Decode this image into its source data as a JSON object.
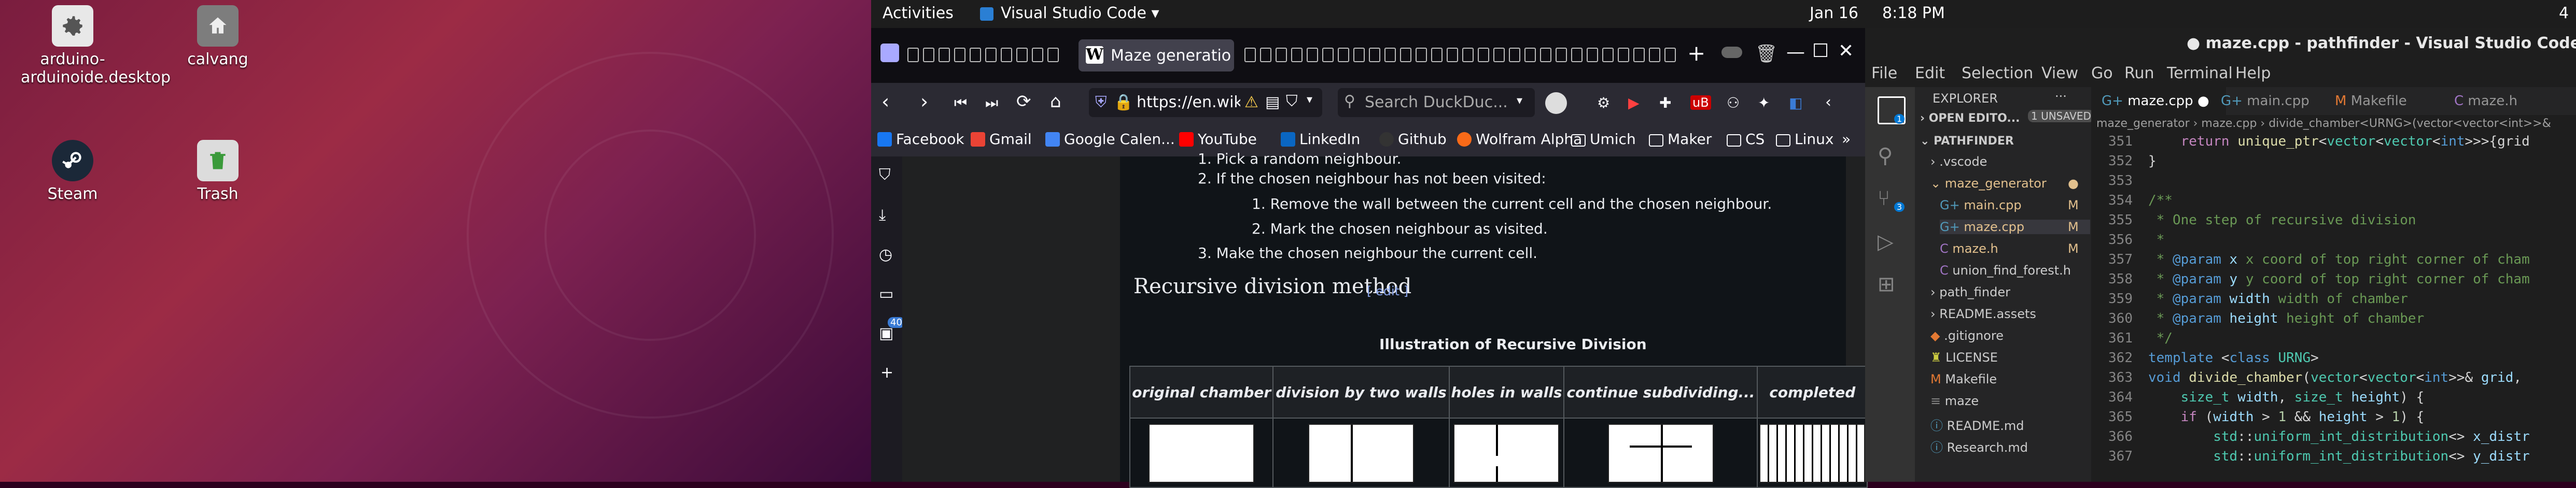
{
  "desktop": {
    "icons": [
      {
        "label": "arduino-arduinoide.desktop",
        "icon": "gear-icon"
      },
      {
        "label": "calvang",
        "icon": "home-folder-icon"
      },
      {
        "label": "Steam",
        "icon": "steam-icon"
      },
      {
        "label": "Trash",
        "icon": "trash-icon"
      }
    ]
  },
  "topbar": {
    "activities": "Activities",
    "app_menu": "Visual Studio Code ▾",
    "date": "Jan 16",
    "time": "8:18 PM",
    "right_fragment": "4"
  },
  "firefox": {
    "active_tab_label": "Maze generatio",
    "url": "https://en.wikipedia.org/wiki/Maze_generation_algorithm",
    "search_placeholder": "Search DuckDuc...",
    "sidebar_badge": "40",
    "bookmarks": [
      {
        "label": "Facebook",
        "color": "#1877f2"
      },
      {
        "label": "Gmail",
        "color": "#ea4335"
      },
      {
        "label": "Google Calen...",
        "color": "#4285f4"
      },
      {
        "label": "YouTube",
        "color": "#ff0000"
      },
      {
        "label": "LinkedIn",
        "color": "#0a66c2"
      },
      {
        "label": "Github",
        "color": "#333333"
      },
      {
        "label": "Wolfram Alpha",
        "color": "#f96a18"
      },
      {
        "label": "Umich",
        "color": "folder"
      },
      {
        "label": "Maker",
        "color": "folder"
      },
      {
        "label": "CS",
        "color": "folder"
      },
      {
        "label": "Linux",
        "color": "folder"
      }
    ],
    "article": {
      "step1": "1. Pick a random neighbour.",
      "step2": "2. If the chosen neighbour has not been visited:",
      "sub1": "1. Remove the wall between the current cell and the chosen neighbour.",
      "sub2": "2. Mark the chosen neighbour as visited.",
      "step3": "3. Make the chosen neighbour the current cell.",
      "heading": "Recursive division method",
      "edit_link": "[ edit ]",
      "table_caption": "Illustration of Recursive Division",
      "columns": [
        "original chamber",
        "division by two walls",
        "holes in walls",
        "continue subdividing...",
        "completed"
      ]
    }
  },
  "vscode": {
    "title": "● maze.cpp - pathfinder - Visual Studio Code",
    "menu": [
      "File",
      "Edit",
      "Selection",
      "View",
      "Go",
      "Run",
      "Terminal",
      "Help"
    ],
    "explorer": {
      "header": "EXPLORER",
      "open_editors": "OPEN EDITO...",
      "unsaved_badge": "1 UNSAVED",
      "root": "PATHFINDER",
      "items": [
        {
          "label": ".vscode",
          "indent": 1,
          "kind": "folder",
          "flag": ""
        },
        {
          "label": "maze_generator",
          "indent": 1,
          "kind": "folder-open",
          "flag": "●"
        },
        {
          "label": "main.cpp",
          "indent": 2,
          "kind": "cpp",
          "flag": "M"
        },
        {
          "label": "maze.cpp",
          "indent": 2,
          "kind": "cpp",
          "flag": "M"
        },
        {
          "label": "maze.h",
          "indent": 2,
          "kind": "h",
          "flag": "M"
        },
        {
          "label": "union_find_forest.h",
          "indent": 2,
          "kind": "h",
          "flag": ""
        },
        {
          "label": "path_finder",
          "indent": 1,
          "kind": "folder",
          "flag": ""
        },
        {
          "label": "README.assets",
          "indent": 1,
          "kind": "folder",
          "flag": ""
        },
        {
          "label": ".gitignore",
          "indent": 1,
          "kind": "file",
          "flag": ""
        },
        {
          "label": "LICENSE",
          "indent": 1,
          "kind": "file",
          "flag": ""
        },
        {
          "label": "Makefile",
          "indent": 1,
          "kind": "file",
          "flag": ""
        },
        {
          "label": "maze",
          "indent": 1,
          "kind": "file",
          "flag": ""
        },
        {
          "label": "README.md",
          "indent": 1,
          "kind": "file",
          "flag": ""
        },
        {
          "label": "Research.md",
          "indent": 1,
          "kind": "file",
          "flag": ""
        }
      ]
    },
    "tabs": [
      {
        "label": "maze.cpp",
        "dirty": "●",
        "active": true
      },
      {
        "label": "main.cpp",
        "dirty": "",
        "active": false
      },
      {
        "label": "Makefile",
        "dirty": "",
        "active": false
      },
      {
        "label": "maze.h",
        "dirty": "",
        "active": false
      }
    ],
    "breadcrumb": "maze_generator  ›  maze.cpp  ›  divide_chamber<URNG>(vector<vector<int>>&",
    "code_lines": [
      {
        "n": "351",
        "html": "    <span class=\"p\">return</span> <span class=\"f\">unique_ptr</span>&lt;<span class=\"t\">vector</span>&lt;<span class=\"t\">vector</span>&lt;<span class=\"k\">int</span>&gt;&gt;&gt;{grid"
      },
      {
        "n": "352",
        "html": "}"
      },
      {
        "n": "353",
        "html": ""
      },
      {
        "n": "354",
        "html": "<span class=\"c\">/**</span>"
      },
      {
        "n": "355",
        "html": "<span class=\"c\"> * One step of recursive division</span>"
      },
      {
        "n": "356",
        "html": "<span class=\"c\"> *</span>"
      },
      {
        "n": "357",
        "html": "<span class=\"c\"> * </span><span class=\"k\">@param</span> <span class=\"v\">x</span><span class=\"c\"> x coord of top right corner of cham</span>"
      },
      {
        "n": "358",
        "html": "<span class=\"c\"> * </span><span class=\"k\">@param</span> <span class=\"v\">y</span><span class=\"c\"> y coord of top right corner of cham</span>"
      },
      {
        "n": "359",
        "html": "<span class=\"c\"> * </span><span class=\"k\">@param</span> <span class=\"v\">width</span><span class=\"c\"> width of chamber</span>"
      },
      {
        "n": "360",
        "html": "<span class=\"c\"> * </span><span class=\"k\">@param</span> <span class=\"v\">height</span><span class=\"c\"> height of chamber</span>"
      },
      {
        "n": "361",
        "html": "<span class=\"c\"> */</span>"
      },
      {
        "n": "362",
        "html": "<span class=\"k\">template</span> &lt;<span class=\"k\">class</span> <span class=\"t\">URNG</span>&gt;"
      },
      {
        "n": "363",
        "html": "<span class=\"k\">void</span> <span class=\"f\">divide_chamber</span>(<span class=\"t\">vector</span>&lt;<span class=\"t\">vector</span>&lt;<span class=\"k\">int</span>&gt;&gt;&amp; <span class=\"v\">grid</span>,"
      },
      {
        "n": "364",
        "html": "    <span class=\"t\">size_t</span> <span class=\"v\">width</span>, <span class=\"t\">size_t</span> <span class=\"v\">height</span>) {"
      },
      {
        "n": "365",
        "html": "    <span class=\"p\">if</span> (<span class=\"v\">width</span> &gt; <span class=\"b\" style=\"color:#b5cea8\">1</span> &amp;&amp; <span class=\"v\">height</span> &gt; <span style=\"color:#b5cea8\">1</span>) {"
      },
      {
        "n": "366",
        "html": "        <span class=\"t\">std</span>::<span class=\"t\">uniform_int_distribution</span>&lt;&gt; <span class=\"v\">x_distr</span>"
      },
      {
        "n": "367",
        "html": "        <span class=\"t\">std</span>::<span class=\"t\">uniform_int_distribution</span>&lt;&gt; <span class=\"v\">y_distr</span>"
      }
    ]
  }
}
